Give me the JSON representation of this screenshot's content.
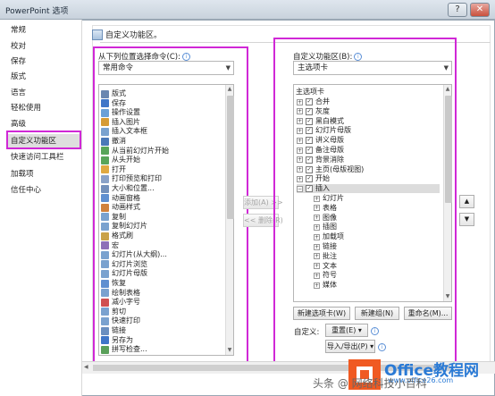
{
  "window": {
    "title": "PowerPoint 选项",
    "help_glyph": "?",
    "close_glyph": "✕"
  },
  "nav": {
    "items": [
      "常规",
      "校对",
      "保存",
      "版式",
      "语言",
      "轻松使用",
      "高级",
      "自定义功能区",
      "快速访问工具栏",
      "加载项",
      "信任中心"
    ]
  },
  "panel": {
    "title": "自定义功能区。"
  },
  "left": {
    "label": "从下列位置选择命令(C):",
    "combo": "常用命令",
    "commands": [
      "版式",
      "保存",
      "操作设置",
      "插入图片",
      "插入文本框",
      "撤消",
      "从当前幻灯片开始",
      "从头开始",
      "打开",
      "打印预览和打印",
      "大小和位置...",
      "动画窗格",
      "动画样式",
      "复制",
      "复制幻灯片",
      "格式刷",
      "宏",
      "幻灯片(从大纲)...",
      "幻灯片浏览",
      "幻灯片母版",
      "恢复",
      "绘制表格",
      "减小字号",
      "剪切",
      "快速打印",
      "链接",
      "另存为",
      "拼写检查..."
    ]
  },
  "middle": {
    "add": "添加(A) >>",
    "remove": "<< 删除(R)"
  },
  "right": {
    "label": "自定义功能区(B):",
    "combo": "主选项卡",
    "tree_header": "主选项卡",
    "tabs": [
      "合并",
      "灰度",
      "黑白模式",
      "幻灯片母版",
      "讲义母版",
      "备注母版",
      "背景消除",
      "主页(母版视图)",
      "开始",
      "插入"
    ],
    "groups": [
      "幻灯片",
      "表格",
      "图像",
      "插图",
      "加载项",
      "链接",
      "批注",
      "文本",
      "符号",
      "媒体"
    ],
    "new_tab": "新建选项卡(W)",
    "new_group": "新建组(N)",
    "rename": "重命名(M)...",
    "customize_label": "自定义:",
    "reset": "重置(E)",
    "import_export": "导入/导出(P)"
  },
  "watermark": {
    "brand": "Office教程网",
    "url": "www.office26.com",
    "text": "头条 @ 网络科技小百科"
  },
  "colors": {
    "highlight": "#d028d6",
    "logo_orange": "#f05a22",
    "brand_blue": "#2a7ad5"
  }
}
